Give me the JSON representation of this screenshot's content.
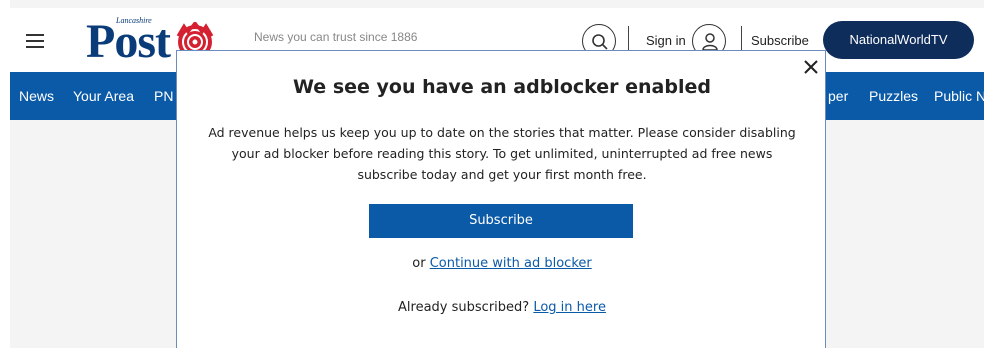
{
  "header": {
    "logo_sub": "Lancashire",
    "logo_main": "Post",
    "tagline": "News you can trust since 1886",
    "signin_label": "Sign in",
    "subscribe_label": "Subscribe",
    "nwtv_label": "NationalWorldTV"
  },
  "nav": {
    "items": [
      "News",
      "Your Area",
      "PN",
      "per",
      "Puzzles",
      "Public N"
    ]
  },
  "modal": {
    "title": "We see you have an adblocker enabled",
    "body": "Ad revenue helps us keep you up to date on the stories that matter. Please consider disabling your ad blocker before reading this story. To get unlimited, uninterrupted ad free news subscribe today and get your first month free.",
    "subscribe_button": "Subscribe",
    "or_text": "or",
    "continue_link": "Continue with ad blocker",
    "already_text": "Already subscribed?",
    "login_link": "Log in here"
  },
  "colors": {
    "brand_blue": "#0b5aa8",
    "navy": "#0e2d5b",
    "logo_blue": "#0b3c7a",
    "rose_red": "#d42030"
  },
  "icons": [
    "menu-icon",
    "rose-icon",
    "search-icon",
    "user-icon",
    "close-icon"
  ]
}
